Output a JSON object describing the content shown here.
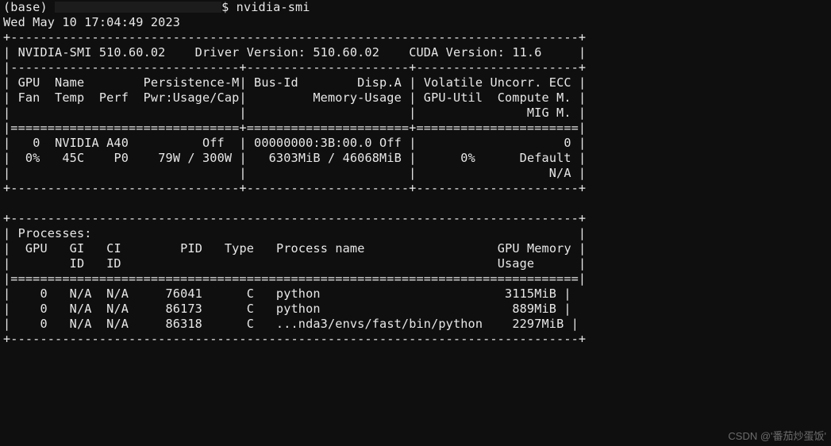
{
  "prompt": {
    "env": "(base)",
    "symbol": "$",
    "cmd": "nvidia-smi"
  },
  "timestamp": "Wed May 10 17:04:49 2023",
  "header": {
    "smi_version": "NVIDIA-SMI 510.60.02",
    "driver_label": "Driver Version:",
    "driver_version": "510.60.02",
    "cuda_label": "CUDA Version:",
    "cuda_version": "11.6"
  },
  "cols": {
    "row1": {
      "c1a": "GPU  Name",
      "c1b": "Persistence-M",
      "c2a": "Bus-Id",
      "c2b": "Disp.A",
      "c3a": "Volatile Uncorr. ECC"
    },
    "row2": {
      "c1a": "Fan  Temp  Perf",
      "c1b": "Pwr:Usage/Cap",
      "c2b": "Memory-Usage",
      "c3a": "GPU-Util  Compute M."
    },
    "row3": {
      "c3a": "MIG M."
    }
  },
  "gpu": {
    "row1": {
      "idx": "0",
      "name": "NVIDIA A40",
      "pm": "Off",
      "busid": "00000000:3B:00.0",
      "disp": "Off",
      "ecc": "0"
    },
    "row2": {
      "fan": "0%",
      "temp": "45C",
      "perf": "P0",
      "pwr": "79W / 300W",
      "mem": "6303MiB / 46068MiB",
      "util": "0%",
      "compute": "Default"
    },
    "row3": {
      "mig": "N/A"
    }
  },
  "proc": {
    "title": "Processes:",
    "h1": {
      "gpu": "GPU",
      "gi": "GI",
      "ci": "CI",
      "pid": "PID",
      "type": "Type",
      "name": "Process name",
      "mem": "GPU Memory"
    },
    "h2": {
      "gi": "ID",
      "ci": "ID",
      "mem": "Usage"
    },
    "rows": [
      {
        "gpu": "0",
        "gi": "N/A",
        "ci": "N/A",
        "pid": "76041",
        "type": "C",
        "name": "python",
        "mem": "3115MiB"
      },
      {
        "gpu": "0",
        "gi": "N/A",
        "ci": "N/A",
        "pid": "86173",
        "type": "C",
        "name": "python",
        "mem": "889MiB"
      },
      {
        "gpu": "0",
        "gi": "N/A",
        "ci": "N/A",
        "pid": "86318",
        "type": "C",
        "name": "...nda3/envs/fast/bin/python",
        "mem": "2297MiB"
      }
    ]
  },
  "watermark": "CSDN @'番茄炒蛋饭'"
}
